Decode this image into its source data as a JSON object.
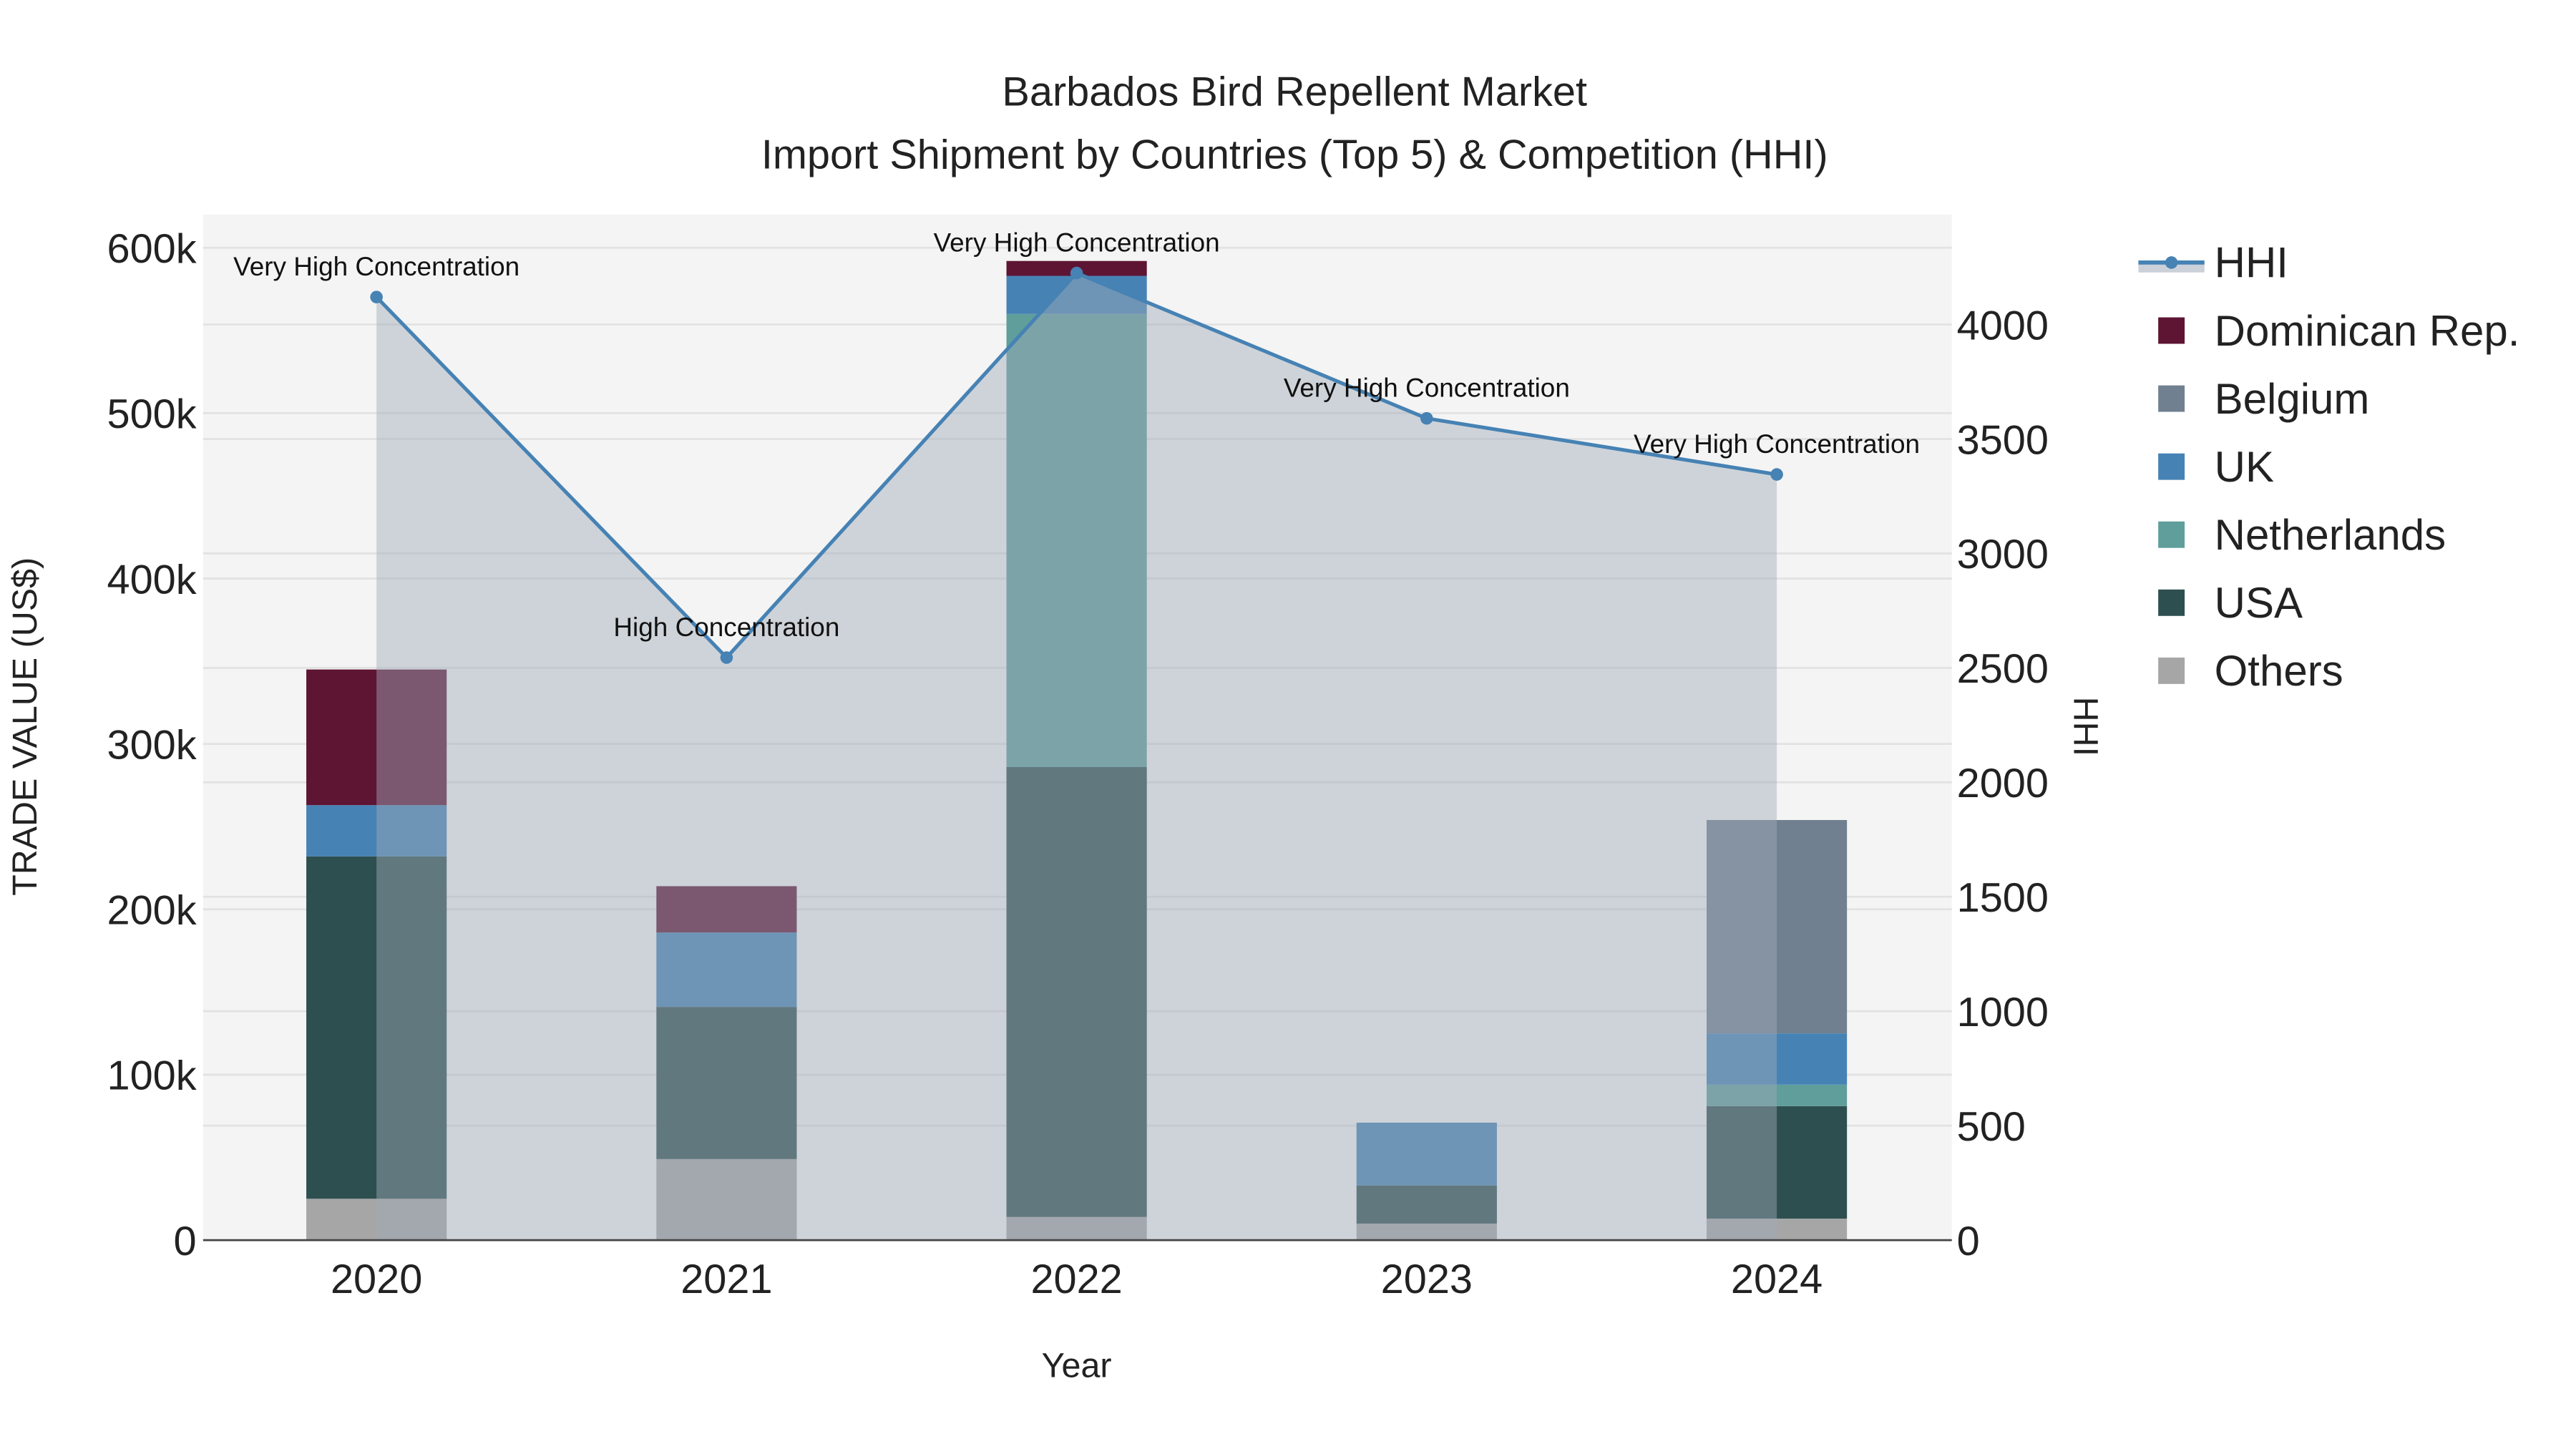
{
  "chart_data": {
    "type": "bar",
    "title": "Barbados Bird Repellent Market",
    "subtitle": "Import Shipment by Countries (Top 5) & Competition (HHI)",
    "xlabel": "Year",
    "ylabel": "TRADE VALUE (US$)",
    "y2label": "HHI",
    "categories": [
      "2020",
      "2021",
      "2022",
      "2023",
      "2024"
    ],
    "ylim": [
      0,
      620000
    ],
    "y_ticks": [
      0,
      100000,
      200000,
      300000,
      400000,
      500000,
      600000
    ],
    "y_tick_labels": [
      "0",
      "100k",
      "200k",
      "300k",
      "400k",
      "500k",
      "600k"
    ],
    "y2lim": [
      0,
      4480
    ],
    "y2_ticks": [
      0,
      500,
      1000,
      1500,
      2000,
      2500,
      3000,
      3500,
      4000
    ],
    "y2_tick_labels": [
      "0",
      "500",
      "1000",
      "1500",
      "2000",
      "2500",
      "3000",
      "3500",
      "4000"
    ],
    "stacked": true,
    "series": [
      {
        "name": "Others",
        "color": "#a6a6a6",
        "values": [
          25000,
          49000,
          14000,
          10000,
          13000
        ]
      },
      {
        "name": "USA",
        "color": "#2e4f4f",
        "values": [
          207000,
          92000,
          272000,
          23000,
          68000
        ]
      },
      {
        "name": "Netherlands",
        "color": "#5f9e9b",
        "values": [
          0,
          0,
          274000,
          0,
          13000
        ]
      },
      {
        "name": "UK",
        "color": "#4682b4",
        "values": [
          31000,
          45000,
          23000,
          38000,
          31000
        ]
      },
      {
        "name": "Belgium",
        "color": "#708090",
        "values": [
          0,
          0,
          0,
          0,
          129000
        ]
      },
      {
        "name": "Dominican Rep.",
        "color": "#5e1433",
        "values": [
          82000,
          28000,
          9000,
          0,
          0
        ]
      }
    ],
    "legend_order": [
      "HHI",
      "Dominican Rep.",
      "Belgium",
      "UK",
      "Netherlands",
      "USA",
      "Others"
    ],
    "line": {
      "name": "HHI",
      "axis": "right",
      "color": "#4682b4",
      "values": [
        4120,
        2545,
        4225,
        3590,
        3345
      ],
      "annotations": [
        "Very High Concentration",
        "High Concentration",
        "Very High Concentration",
        "Very High Concentration",
        "Very High Concentration"
      ]
    },
    "legend_position": "right",
    "grid": true
  }
}
